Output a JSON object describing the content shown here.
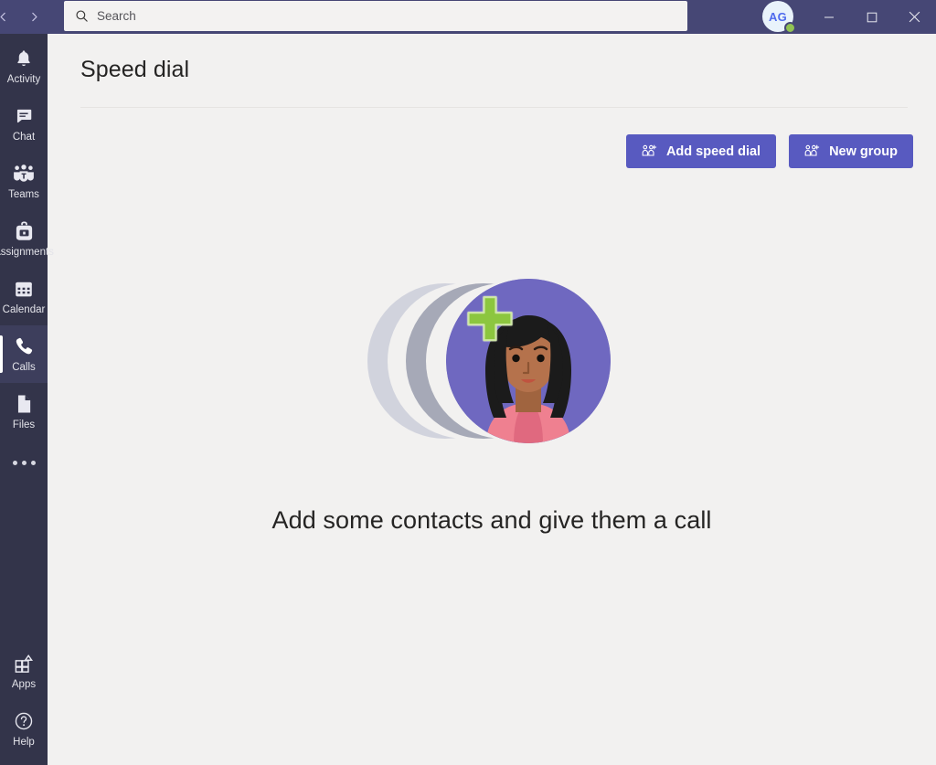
{
  "titlebar": {
    "back_icon": "back-arrow-icon",
    "forward_icon": "forward-arrow-icon",
    "search": {
      "placeholder": "Search",
      "value": "",
      "icon": "search-icon"
    },
    "avatar": {
      "initials": "AG",
      "presence": "available",
      "presence_color": "#92c353"
    },
    "window_controls": {
      "minimize_label": "Minimize",
      "maximize_label": "Maximize",
      "close_label": "Close"
    }
  },
  "sidebar": {
    "background": "#33344a",
    "active_background": "#3d3e5c",
    "items": [
      {
        "label": "Activity",
        "icon": "bell-icon",
        "active": false
      },
      {
        "label": "Chat",
        "icon": "chat-icon",
        "active": false
      },
      {
        "label": "Teams",
        "icon": "teams-icon",
        "active": false
      },
      {
        "label": "Assignments",
        "icon": "backpack-icon",
        "active": false
      },
      {
        "label": "Calendar",
        "icon": "calendar-icon",
        "active": false
      },
      {
        "label": "Calls",
        "icon": "phone-icon",
        "active": true
      },
      {
        "label": "Files",
        "icon": "file-icon",
        "active": false
      }
    ],
    "more_label": "More options",
    "more_icon": "ellipsis-icon",
    "bottom_items": [
      {
        "label": "Apps",
        "icon": "apps-icon"
      },
      {
        "label": "Help",
        "icon": "help-icon"
      }
    ]
  },
  "main": {
    "page_title": "Speed dial",
    "buttons": [
      {
        "label": "Add speed dial",
        "icon": "add-person-icon",
        "color": "#585ac0"
      },
      {
        "label": "New group",
        "icon": "add-person-icon",
        "color": "#585ac0"
      }
    ],
    "empty_state": {
      "heading": "Add some contacts and give them a call",
      "illustration": {
        "name": "contacts-avatars-illustration",
        "circle_back_color": "#d1d3dd",
        "circle_mid_color": "#a6a9b7",
        "circle_front_color": "#6f68c0",
        "plus_color": "#8cc63f",
        "hair_color": "#1b1b1b",
        "skin_color": "#b5724c",
        "shirt_color": "#ef8090"
      }
    }
  }
}
